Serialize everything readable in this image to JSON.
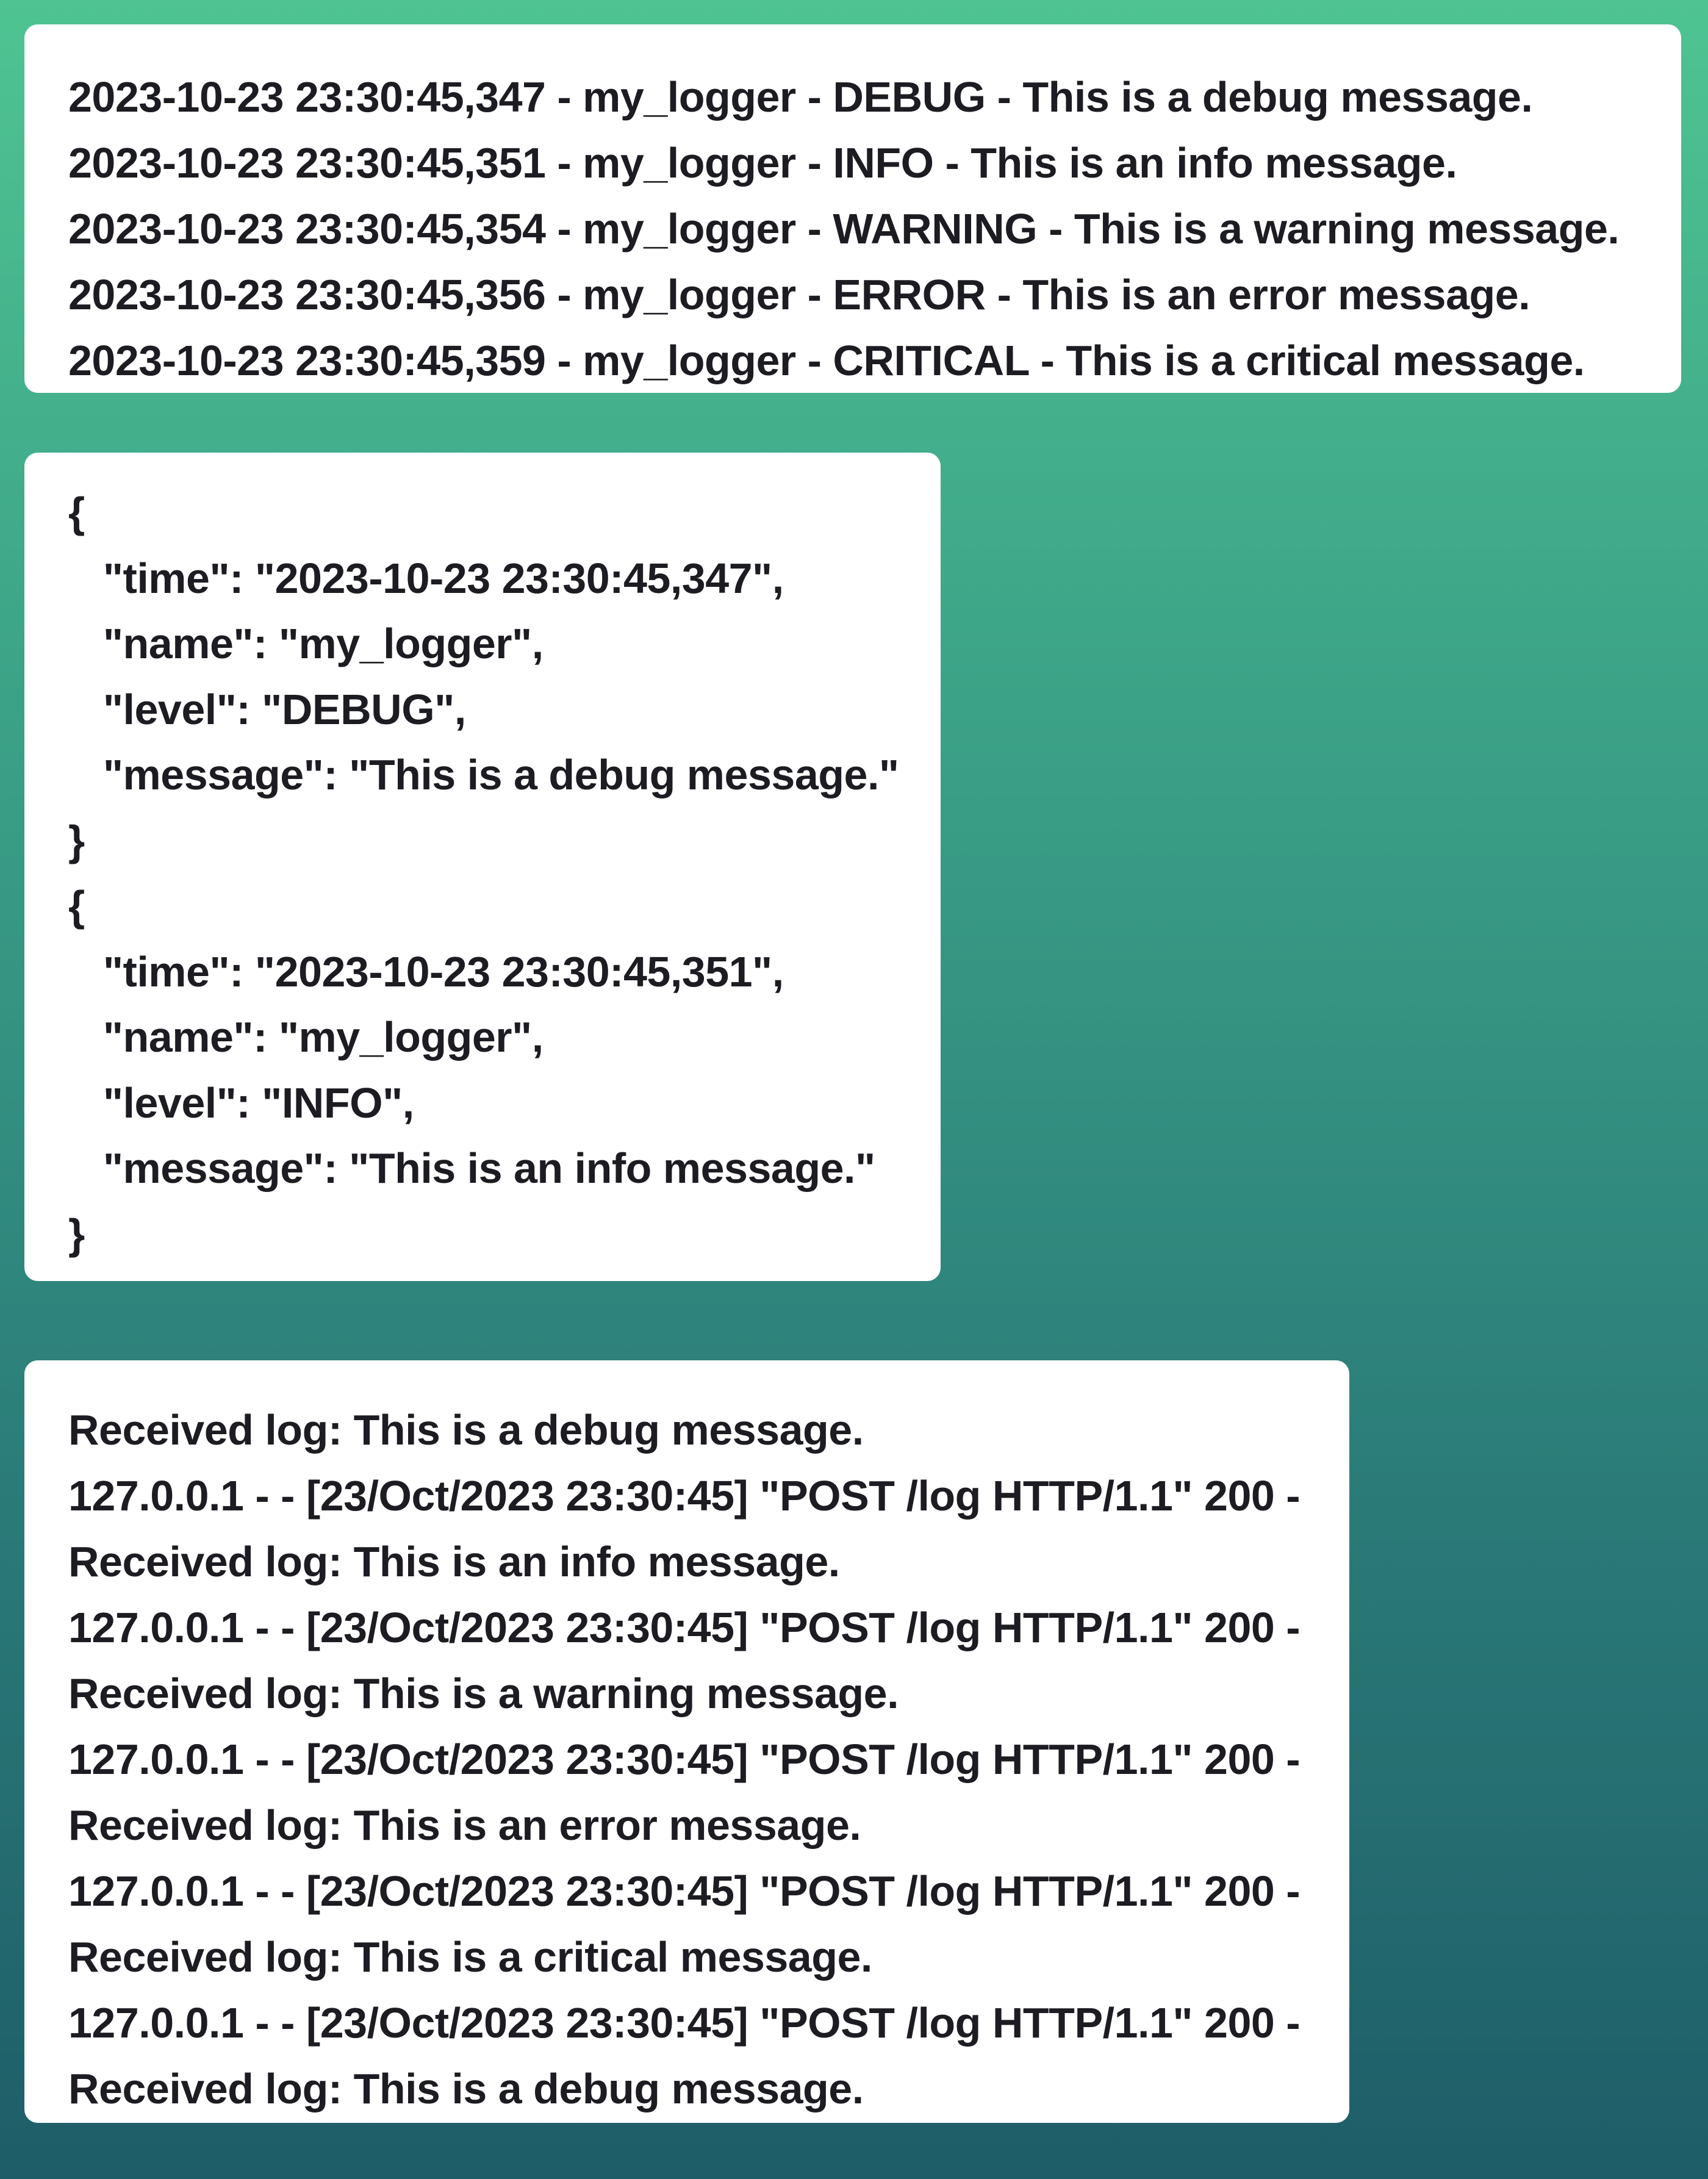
{
  "console_log_lines": [
    "2023-10-23 23:30:45,347 - my_logger - DEBUG - This is a debug message.",
    "2023-10-23 23:30:45,351 - my_logger - INFO - This is an info message.",
    "2023-10-23 23:30:45,354 - my_logger - WARNING - This is a warning message.",
    "2023-10-23 23:30:45,356 - my_logger - ERROR - This is an error message.",
    "2023-10-23 23:30:45,359 - my_logger - CRITICAL - This is a critical message."
  ],
  "json_log_lines": [
    "{",
    "   \"time\": \"2023-10-23 23:30:45,347\",",
    "   \"name\": \"my_logger\",",
    "   \"level\": \"DEBUG\",",
    "   \"message\": \"This is a debug message.\"",
    "}",
    "{",
    "   \"time\": \"2023-10-23 23:30:45,351\",",
    "   \"name\": \"my_logger\",",
    "   \"level\": \"INFO\",",
    "   \"message\": \"This is an info message.\"",
    "}"
  ],
  "server_log_lines": [
    "Received log: This is a debug message.",
    "127.0.0.1 - - [23/Oct/2023 23:30:45] \"POST /log HTTP/1.1\" 200 -",
    "Received log: This is an info message.",
    "127.0.0.1 - - [23/Oct/2023 23:30:45] \"POST /log HTTP/1.1\" 200 -",
    "Received log: This is a warning message.",
    "127.0.0.1 - - [23/Oct/2023 23:30:45] \"POST /log HTTP/1.1\" 200 -",
    "Received log: This is an error message.",
    "127.0.0.1 - - [23/Oct/2023 23:30:45] \"POST /log HTTP/1.1\" 200 -",
    "Received log: This is a critical message.",
    "127.0.0.1 - - [23/Oct/2023 23:30:45] \"POST /log HTTP/1.1\" 200 -",
    "Received log: This is a debug message."
  ],
  "colors": {
    "background_top": "#4fc492",
    "background_bottom": "#1e5d68",
    "panel_background": "#ffffff",
    "text": "#1c1c22"
  }
}
